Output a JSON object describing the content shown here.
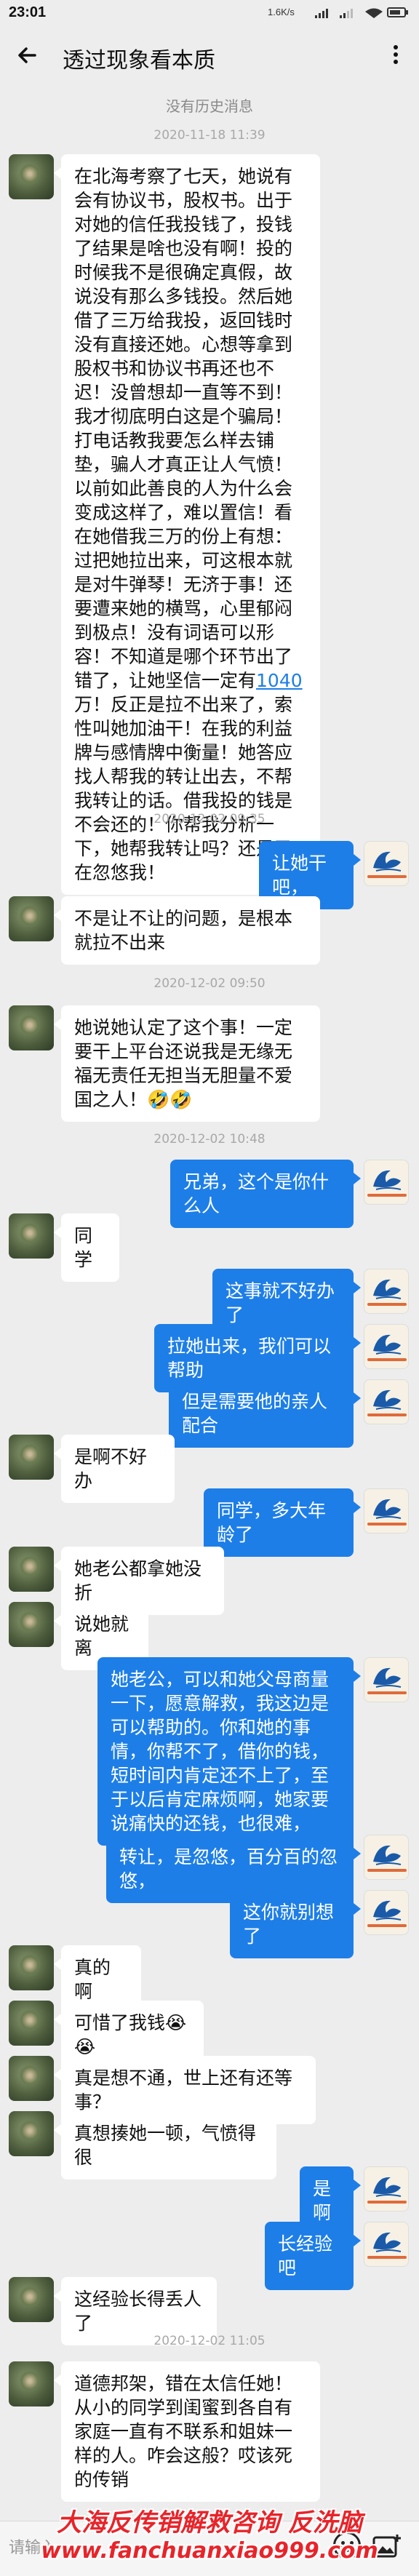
{
  "status_bar": {
    "time": "23:01",
    "network_speed": "1.6K/s"
  },
  "title_bar": {
    "title": "透过现象看本质"
  },
  "history_notice": "没有历史消息",
  "messages": [
    {
      "type": "time",
      "text": "2020-11-18 11:39"
    },
    {
      "type": "msg",
      "side": "left",
      "text": "在北海考察了七天，她说有会有协议书，股权书。出于对她的信任我投钱了，投钱了结果是啥也没有啊！投的时候我不是很确定真假，故说没有那么多钱投。然后她借了三万给我投，返回钱时没有直接还她。心想等拿到股权书和协议书再还也不迟！没曾想却一直等不到！我才彻底明白这是个骗局！打电话教我要怎么样去铺垫，骗人才真正让人气愤！以前如此善良的人为什么会变成这样了，难以置信！看在她借我三万的份上有想：过把她拉出来，可这根本就是对牛弹琴！无济于事！还要遭来她的横骂，心里郁闷到极点！没有词语可以形容！不知道是哪个环节出了错了，让她坚信一定有",
      "link": "1040",
      "tail": "万！反正是拉不出来了，索性叫她加油干！在我的利益牌与感情牌中衡量！她答应找人帮我的转让出去，不帮我转让的话。借我投的钱是不会还的！你帮我分析一下，她帮我转让吗？还是又在忽悠我！"
    },
    {
      "type": "time",
      "text": "2020-12-02 09:35"
    },
    {
      "type": "msg",
      "side": "right",
      "text": "让她干吧，"
    },
    {
      "type": "msg",
      "side": "left",
      "text": "不是让不让的问题，是根本就拉不出来"
    },
    {
      "type": "time",
      "text": "2020-12-02 09:50"
    },
    {
      "type": "msg",
      "side": "left",
      "text": "她说她认定了这个事！一定要干上平台还说我是无缘无福无责任无担当无胆量不爱国之人！🤣🤣"
    },
    {
      "type": "time",
      "text": "2020-12-02 10:48"
    },
    {
      "type": "msg",
      "side": "right",
      "text": "兄弟，这个是你什么人"
    },
    {
      "type": "msg",
      "side": "left",
      "text": "同学"
    },
    {
      "type": "msg",
      "side": "right",
      "text": "这事就不好办了"
    },
    {
      "type": "msg",
      "side": "right",
      "text": "拉她出来，我们可以帮助"
    },
    {
      "type": "msg",
      "side": "right",
      "text": "但是需要他的亲人配合"
    },
    {
      "type": "msg",
      "side": "left",
      "text": "是啊不好办"
    },
    {
      "type": "msg",
      "side": "right",
      "text": "同学，多大年龄了"
    },
    {
      "type": "msg",
      "side": "left",
      "text": "她老公都拿她没折"
    },
    {
      "type": "msg",
      "side": "left",
      "text": "说她就离"
    },
    {
      "type": "msg",
      "side": "right",
      "text": "她老公，可以和她父母商量一下，愿意解救，我这边是可以帮助的。你和她的事情，你帮不了，借你的钱，短时间内肯定还不上了，至于以后肯定麻烦啊，她家要说痛快的还钱，也很难，"
    },
    {
      "type": "msg",
      "side": "right",
      "text": "转让，是忽悠，百分百的忽悠，"
    },
    {
      "type": "msg",
      "side": "right",
      "text": "这你就别想了"
    },
    {
      "type": "msg",
      "side": "left",
      "text": "真的啊"
    },
    {
      "type": "msg",
      "side": "left",
      "text": "可惜了我钱😭😭"
    },
    {
      "type": "msg",
      "side": "left",
      "text": "真是想不通，世上还有还等事？"
    },
    {
      "type": "msg",
      "side": "left",
      "text": "真想揍她一顿，气愤得很"
    },
    {
      "type": "msg",
      "side": "right",
      "text": "是啊"
    },
    {
      "type": "msg",
      "side": "right",
      "text": "长经验吧"
    },
    {
      "type": "msg",
      "side": "left",
      "text": "这经验长得丢人了"
    },
    {
      "type": "time",
      "text": "2020-12-02 11:05"
    },
    {
      "type": "msg",
      "side": "left",
      "text": "道德邦架，错在太信任她！从小的同学到闺蜜到各自有家庭一直有不联系和姐妹一样的人。咋会这般？哎该死的传销"
    }
  ],
  "input_bar": {
    "placeholder": "请输入"
  },
  "watermark": {
    "line1": "大海反传销解救咨询  反洗脑",
    "line2": "www.fanchuanxiao999.com"
  },
  "colors": {
    "bubble_right": "#1d7ee8",
    "bubble_left": "#ffffff",
    "background": "#ededed",
    "watermark": "#e8242a"
  },
  "icons": {
    "back": "arrow-left-icon",
    "more": "more-vertical-icon",
    "emoji": "emoji-icon",
    "image": "image-add-icon"
  }
}
